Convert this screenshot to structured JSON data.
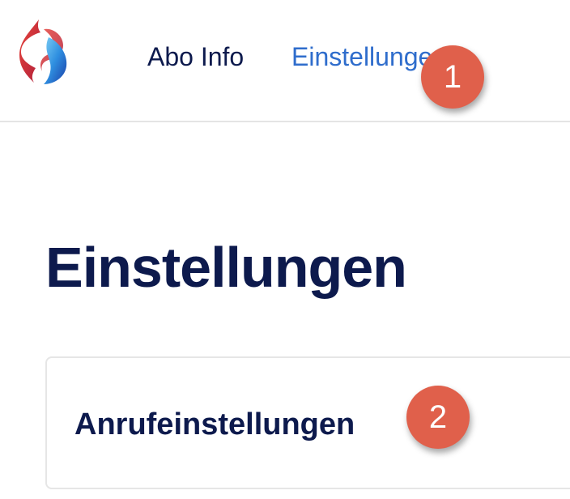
{
  "header": {
    "logo": "swisscom-logo",
    "nav": [
      {
        "label": "Abo Info",
        "active": false
      },
      {
        "label": "Einstellungen",
        "active": true
      }
    ]
  },
  "annotations": [
    {
      "label": "1"
    },
    {
      "label": "2"
    }
  ],
  "main": {
    "title": "Einstellungen",
    "cards": [
      {
        "label": "Anrufeinstellungen"
      }
    ]
  },
  "colors": {
    "text_primary": "#0d1a4d",
    "nav_active": "#2f6dcc",
    "badge": "#e0604b",
    "divider": "#e4e4e4"
  }
}
